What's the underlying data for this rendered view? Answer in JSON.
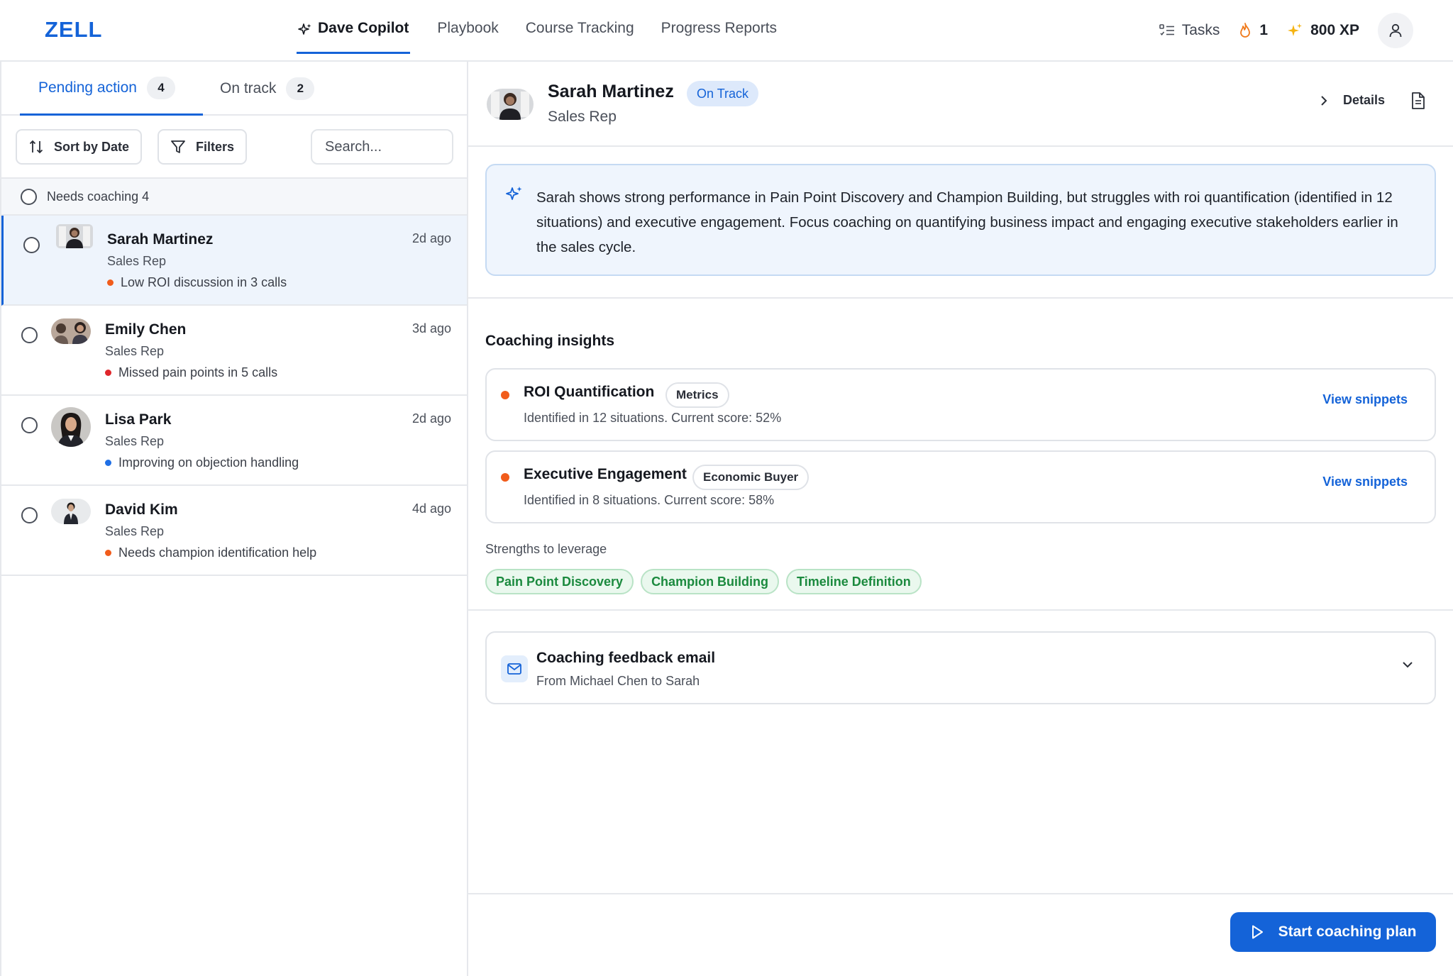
{
  "app": {
    "logo": "ZELL"
  },
  "nav": {
    "items": [
      {
        "label": "Dave Copilot",
        "active": true,
        "icon": "sparkle-icon"
      },
      {
        "label": "Playbook"
      },
      {
        "label": "Course Tracking"
      },
      {
        "label": "Progress Reports"
      }
    ]
  },
  "topright": {
    "tasks_label": "Tasks",
    "streak_count": "1",
    "xp_label": "800 XP"
  },
  "left": {
    "tabs": [
      {
        "label": "Pending action",
        "count": "4",
        "active": true
      },
      {
        "label": "On track",
        "count": "2"
      }
    ],
    "sort_label": "Sort by Date",
    "filters_label": "Filters",
    "search_placeholder": "Search...",
    "group_label": "Needs coaching 4",
    "reps": [
      {
        "name": "Sarah Martinez",
        "role": "Sales Rep",
        "note": "Low ROI discussion in 3 calls",
        "note_color": "#f15c1b",
        "time": "2d ago",
        "selected": true
      },
      {
        "name": "Emily Chen",
        "role": "Sales Rep",
        "note": "Missed pain points in 5 calls",
        "note_color": "#e0262b",
        "time": "3d ago"
      },
      {
        "name": "Lisa Park",
        "role": "Sales Rep",
        "note": "Improving on objection handling",
        "note_color": "#1f6fe5",
        "time": "2d ago"
      },
      {
        "name": "David Kim",
        "role": "Sales Rep",
        "note": "Needs champion identification help",
        "note_color": "#f15c1b",
        "time": "4d ago"
      }
    ]
  },
  "profile": {
    "name": "Sarah Martinez",
    "status": "On Track",
    "role": "Sales Rep",
    "details_label": "Details"
  },
  "summary": {
    "text": "Sarah shows strong performance in Pain Point Discovery and Champion Building, but struggles with roi quantification (identified in 12 situations) and executive engagement. Focus coaching on quantifying business impact and engaging executive stakeholders earlier in the sales cycle."
  },
  "insights": {
    "title": "Coaching insights",
    "items": [
      {
        "title": "ROI Quantification",
        "tag": "Metrics",
        "desc": "Identified in 12 situations. Current score: 52%",
        "link": "View snippets"
      },
      {
        "title": "Executive Engagement",
        "tag": "Economic Buyer",
        "desc": "Identified in 8 situations. Current score: 58%",
        "link": "View snippets"
      }
    ],
    "strengths_label": "Strengths to leverage",
    "strengths": [
      "Pain Point Discovery",
      "Champion Building",
      "Timeline Definition"
    ]
  },
  "email": {
    "title": "Coaching feedback email",
    "sub": "From Michael Chen to Sarah"
  },
  "cta": {
    "label": "Start coaching plan"
  },
  "colors": {
    "accent": "#1463d8",
    "warning": "#f15c1b",
    "success": "#1b8a3e"
  }
}
